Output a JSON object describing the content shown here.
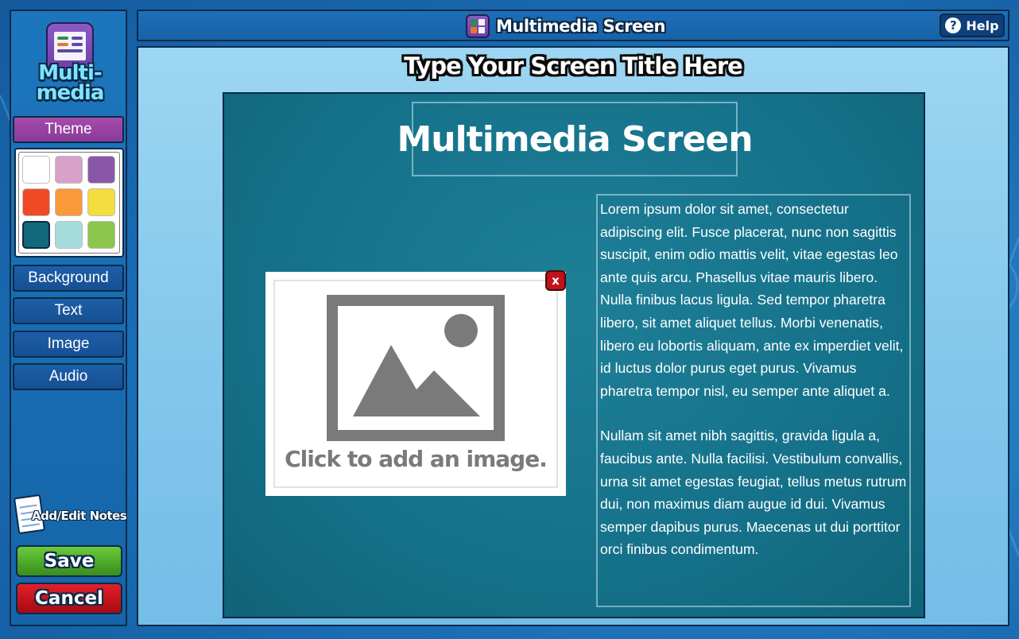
{
  "sidebar": {
    "logo_text_line1": "Multi-",
    "logo_text_line2": "media",
    "theme_label": "Theme",
    "palette": [
      {
        "name": "white",
        "color": "#ffffff"
      },
      {
        "name": "pink",
        "color": "#d7a1c9"
      },
      {
        "name": "purple",
        "color": "#8a57a8"
      },
      {
        "name": "red",
        "color": "#f04a24"
      },
      {
        "name": "orange",
        "color": "#f9993a"
      },
      {
        "name": "yellow",
        "color": "#f4dd3e"
      },
      {
        "name": "teal",
        "color": "#13677d"
      },
      {
        "name": "light-cyan",
        "color": "#a4dcde"
      },
      {
        "name": "green",
        "color": "#8cc54c"
      }
    ],
    "selected_swatch": "teal",
    "buttons": {
      "background": "Background",
      "text": "Text",
      "image": "Image",
      "audio": "Audio"
    },
    "notes_label": "Add/Edit Notes",
    "save_label": "Save",
    "cancel_label": "Cancel"
  },
  "topbar": {
    "title": "Multimedia Screen",
    "help_label": "Help"
  },
  "editor": {
    "screen_title_placeholder": "Type Your Screen Title Here",
    "slide": {
      "heading": "Multimedia Screen",
      "image_caption": "Click to add an image.",
      "close_label": "x",
      "paragraph1": "Lorem ipsum dolor sit amet, consectetur adipiscing elit. Fusce placerat, nunc non sagittis suscipit, enim odio mattis velit, vitae egestas leo ante quis arcu. Phasellus vitae mauris libero. Nulla finibus lacus ligula. Sed tempor pharetra libero, sit amet aliquet tellus. Morbi venenatis, libero eu lobortis aliquam, ante ex imperdiet velit, id luctus dolor purus eget purus. Vivamus pharetra tempor nisl, eu semper ante aliquet a.",
      "paragraph2": "Nullam sit amet nibh sagittis, gravida ligula a, faucibus ante. Nulla facilisi. Vestibulum convallis, urna sit amet egestas feugiat, tellus metus rutrum dui, non maximus diam augue id dui. Vivamus semper dapibus purus. Maecenas ut dui porttitor orci finibus condimentum."
    }
  },
  "colors": {
    "app_background": "#1a6db5",
    "slide_background": "#15718a",
    "theme_button": "#8b3a98",
    "save_button": "#4aa628",
    "cancel_button": "#c0121b"
  }
}
